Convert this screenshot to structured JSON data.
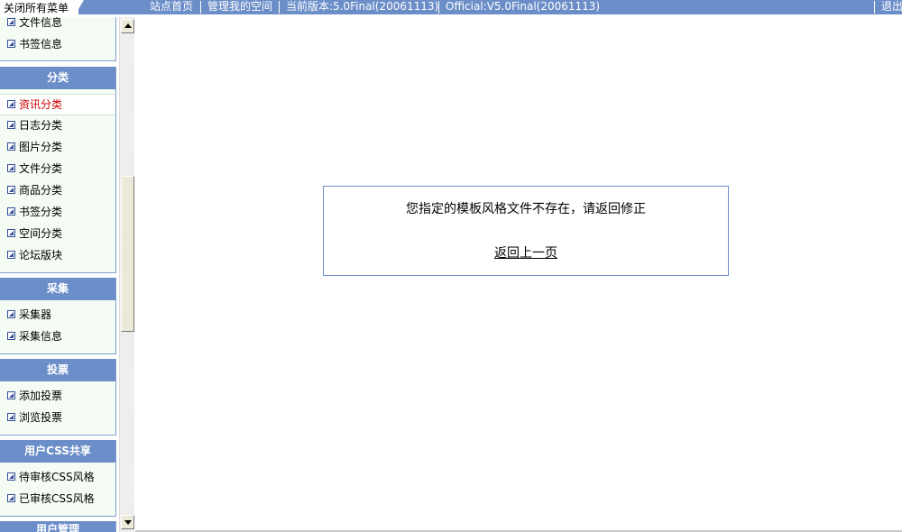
{
  "topbar": {
    "close_all": "关闭所有菜单",
    "links": [
      "站点首页",
      "管理我的空间",
      "当前版本:5.0Final(20061113)",
      "Official:V5.0Final(20061113)",
      "退出"
    ]
  },
  "menu": {
    "partial_top": {
      "items": [
        "文件信息",
        "书签信息"
      ]
    },
    "category": {
      "title": "分类",
      "items": [
        "资讯分类",
        "日志分类",
        "图片分类",
        "文件分类",
        "商品分类",
        "书签分类",
        "空间分类",
        "论坛版块"
      ],
      "active": "资讯分类"
    },
    "collect": {
      "title": "采集",
      "items": [
        "采集器",
        "采集信息"
      ]
    },
    "vote": {
      "title": "投票",
      "items": [
        "添加投票",
        "浏览投票"
      ]
    },
    "css_share": {
      "title": "用户CSS共享",
      "items": [
        "待审核CSS风格",
        "已审核CSS风格"
      ]
    },
    "user_manage": {
      "title": "用户管理"
    }
  },
  "message": {
    "text": "您指定的模板风格文件不存在，请返回修正",
    "back_link": "返回上一页"
  },
  "colors": {
    "header_blue": "#6b8ec8",
    "menu_bg": "#f4fcf4",
    "active_red": "#d00000"
  }
}
